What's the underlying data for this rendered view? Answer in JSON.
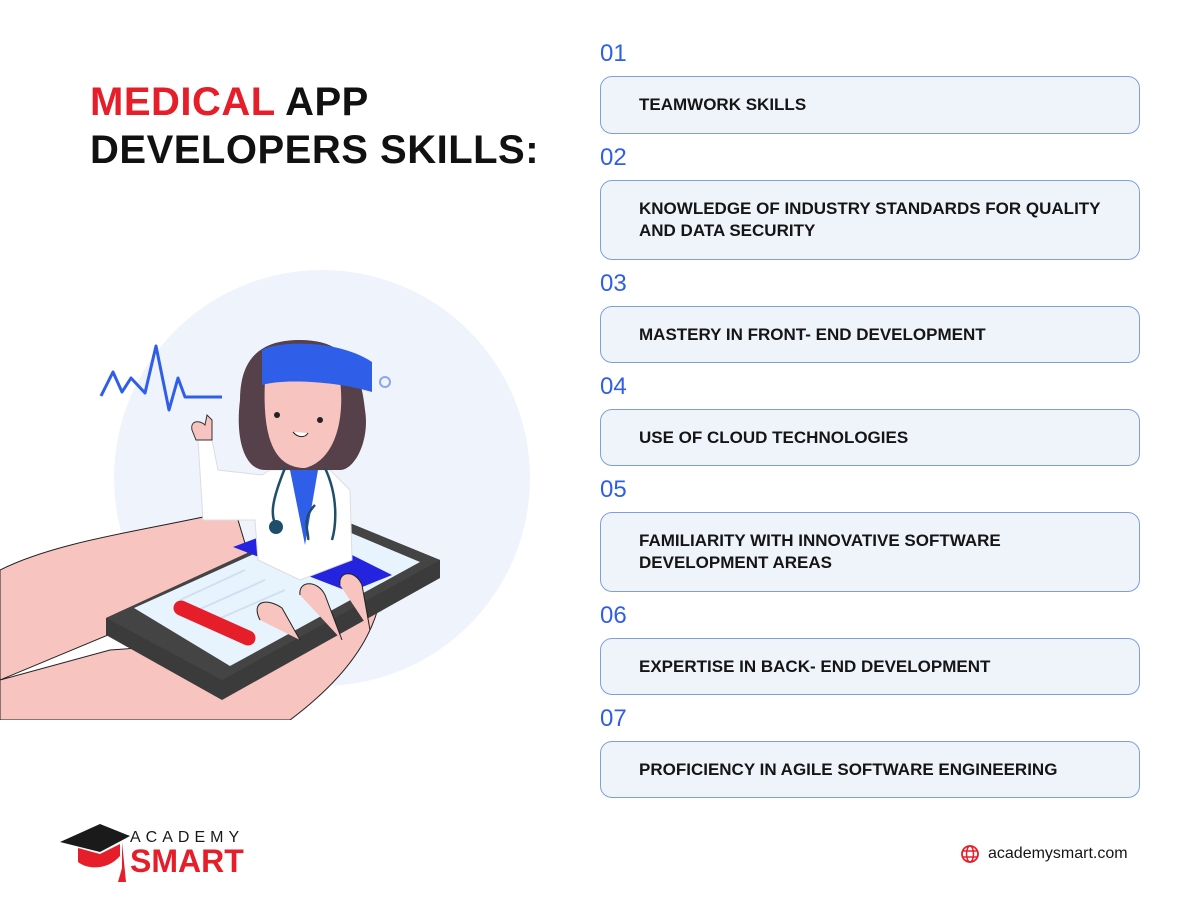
{
  "title": {
    "accent": "MEDICAL",
    "rest_line1": " APP",
    "line2": "DEVELOPERS SKILLS:"
  },
  "colors": {
    "accent_red": "#e61e2a",
    "accent_blue": "#2f5ee8",
    "box_fill": "#eff4fb",
    "box_border": "#7f9fdc",
    "text": "#151515"
  },
  "skills": [
    {
      "num": "01",
      "label": "TEAMWORK SKILLS"
    },
    {
      "num": "02",
      "label": "KNOWLEDGE OF INDUSTRY STANDARDS FOR QUALITY AND DATA SECURITY"
    },
    {
      "num": "03",
      "label": "MASTERY IN FRONT- END DEVELOPMENT"
    },
    {
      "num": "04",
      "label": "USE OF CLOUD TECHNOLOGIES"
    },
    {
      "num": "05",
      "label": "FAMILIARITY WITH INNOVATIVE SOFTWARE DEVELOPMENT AREAS"
    },
    {
      "num": "06",
      "label": "EXPERTISE IN BACK- END DEVELOPMENT"
    },
    {
      "num": "07",
      "label": "PROFICIENCY IN AGILE SOFTWARE ENGINEERING"
    }
  ],
  "logo": {
    "line1": "ACADEMY",
    "line2": "SMART"
  },
  "footer": {
    "website": "academysmart.com",
    "icon": "globe-icon"
  },
  "illustration": {
    "subject": "doctor emerging from smartphone held in hand",
    "icons": [
      "heartbeat-icon",
      "stethoscope-icon"
    ]
  }
}
